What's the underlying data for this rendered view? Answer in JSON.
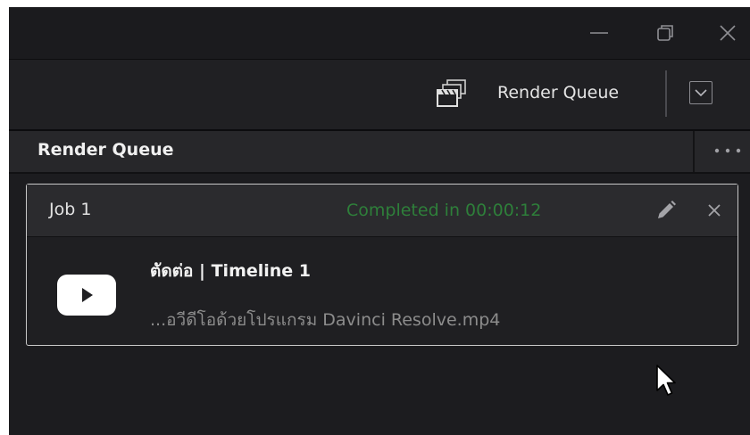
{
  "window": {
    "controls": {
      "minimize": "minimize-icon",
      "restore": "restore-icon",
      "close": "close-icon"
    }
  },
  "toolbar": {
    "render_queue_label": "Render Queue",
    "icon": "render-queue-icon",
    "dropdown_icon": "chevron-down-icon"
  },
  "panel": {
    "title": "Render Queue",
    "options_icon": "more-options-icon"
  },
  "jobs": [
    {
      "title": "Job 1",
      "status": "Completed in 00:00:12",
      "status_color": "#2e7f3a",
      "name": "ตัดต่อ | Timeline 1",
      "file": "...อวีดีโอด้วยโปรแกรม Davinci Resolve.mp4",
      "thumbnail_icon": "youtube-play-icon"
    }
  ],
  "colors": {
    "window_bg": "#1c1c1f",
    "panel_header_bg": "#27272a",
    "job_header_bg": "#2b2b2e",
    "text": "#e4e4e4",
    "muted_text": "#8c8c8c"
  }
}
